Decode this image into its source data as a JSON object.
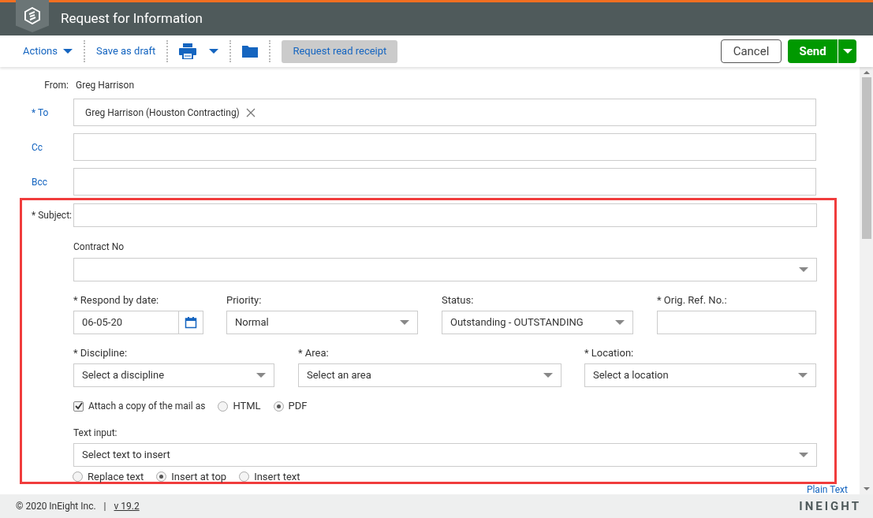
{
  "window": {
    "title": "Request for Information"
  },
  "toolbar": {
    "actions": "Actions",
    "save_draft": "Save as draft",
    "read_receipt": {
      "label": "Request read receipt",
      "selected": true
    },
    "cancel": "Cancel",
    "send": "Send"
  },
  "from": {
    "label": "From:",
    "value": "Greg Harrison"
  },
  "recipients": [
    {
      "label": "* To",
      "chips": [
        "Greg Harrison (Houston Contracting)"
      ]
    },
    {
      "label": "Cc"
    },
    {
      "label": "Bcc"
    }
  ],
  "form": {
    "subject_label": "* Subject:",
    "contract_label": "Contract No",
    "row1": [
      {
        "kind": "date",
        "label": "* Respond by date:",
        "value": "06-05-20"
      },
      {
        "kind": "select",
        "label": "Priority:",
        "value": "Normal"
      },
      {
        "kind": "select",
        "label": "Status:",
        "value": "Outstanding - OUTSTANDING"
      },
      {
        "kind": "text",
        "label": "* Orig. Ref. No.:"
      }
    ],
    "row2": [
      {
        "kind": "select",
        "label": "* Discipline:",
        "value": "Select a discipline"
      },
      {
        "kind": "select",
        "label": "* Area:",
        "value": "Select an area"
      },
      {
        "kind": "select",
        "label": "* Location:",
        "value": "Select a location"
      }
    ],
    "attach": {
      "label": "Attach a copy of the mail as",
      "checked": true,
      "options": [
        {
          "label": "HTML",
          "selected": false
        },
        {
          "label": "PDF",
          "selected": true
        }
      ]
    },
    "text_input_label": "Text input:",
    "text_input_value": "Select text to insert",
    "insert_modes": [
      {
        "label": "Replace text",
        "selected": false
      },
      {
        "label": "Insert at top",
        "selected": true
      },
      {
        "label": "Insert text",
        "selected": false
      }
    ]
  },
  "plain_text_link": "Plain Text",
  "footer": {
    "copyright": "© 2020 InEight Inc.",
    "separator": "|",
    "version": "v 19.2",
    "brand": "INEIGHT"
  }
}
